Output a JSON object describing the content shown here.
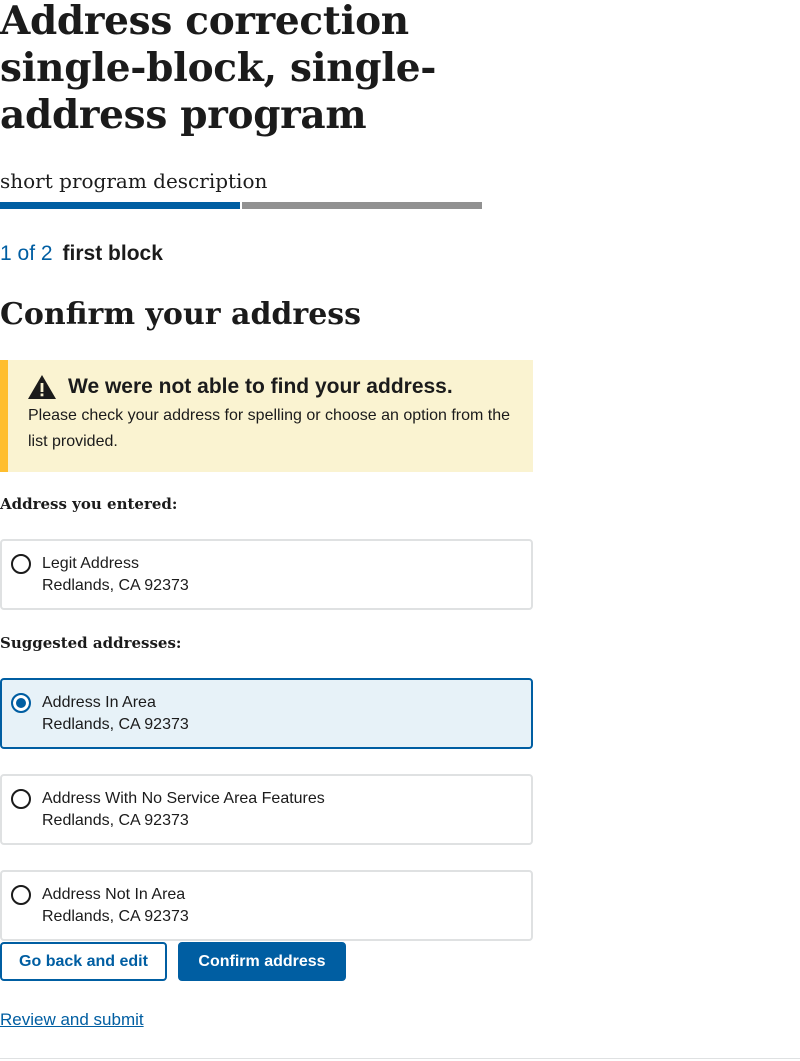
{
  "program": {
    "title": "Address correction single-block, single-address program",
    "description": "short program description"
  },
  "progress": {
    "current_step": 1,
    "total_steps": 2,
    "completed_fraction": 0.5,
    "done_color": "#005ea2",
    "todo_color": "#919191"
  },
  "step": {
    "count": "1 of 2",
    "name": "first block"
  },
  "page": {
    "heading": "Confirm your address"
  },
  "alert": {
    "icon": "warning-icon",
    "title": "We were not able to find your address.",
    "body": "Please check your address for spelling or choose an option from the list provided.",
    "background_color": "#faf3d1",
    "accent_color": "#ffbe2e"
  },
  "entered": {
    "label": "Address you entered:",
    "options": [
      {
        "line1": "Legit Address",
        "line2": "Redlands, CA 92373",
        "selected": false
      }
    ]
  },
  "suggested": {
    "label": "Suggested addresses:",
    "options": [
      {
        "line1": "Address In Area",
        "line2": "Redlands, CA 92373",
        "selected": true
      },
      {
        "line1": "Address With No Service Area Features",
        "line2": "Redlands, CA 92373",
        "selected": false
      },
      {
        "line1": "Address Not In Area",
        "line2": "Redlands, CA 92373",
        "selected": false
      }
    ]
  },
  "actions": {
    "back_label": "Go back and edit",
    "confirm_label": "Confirm address",
    "review_link": "Review and submit"
  },
  "colors": {
    "primary": "#005ea2",
    "text": "#1b1b1b",
    "border": "#dfe1e2",
    "selected_bg": "#e7f2f8"
  }
}
